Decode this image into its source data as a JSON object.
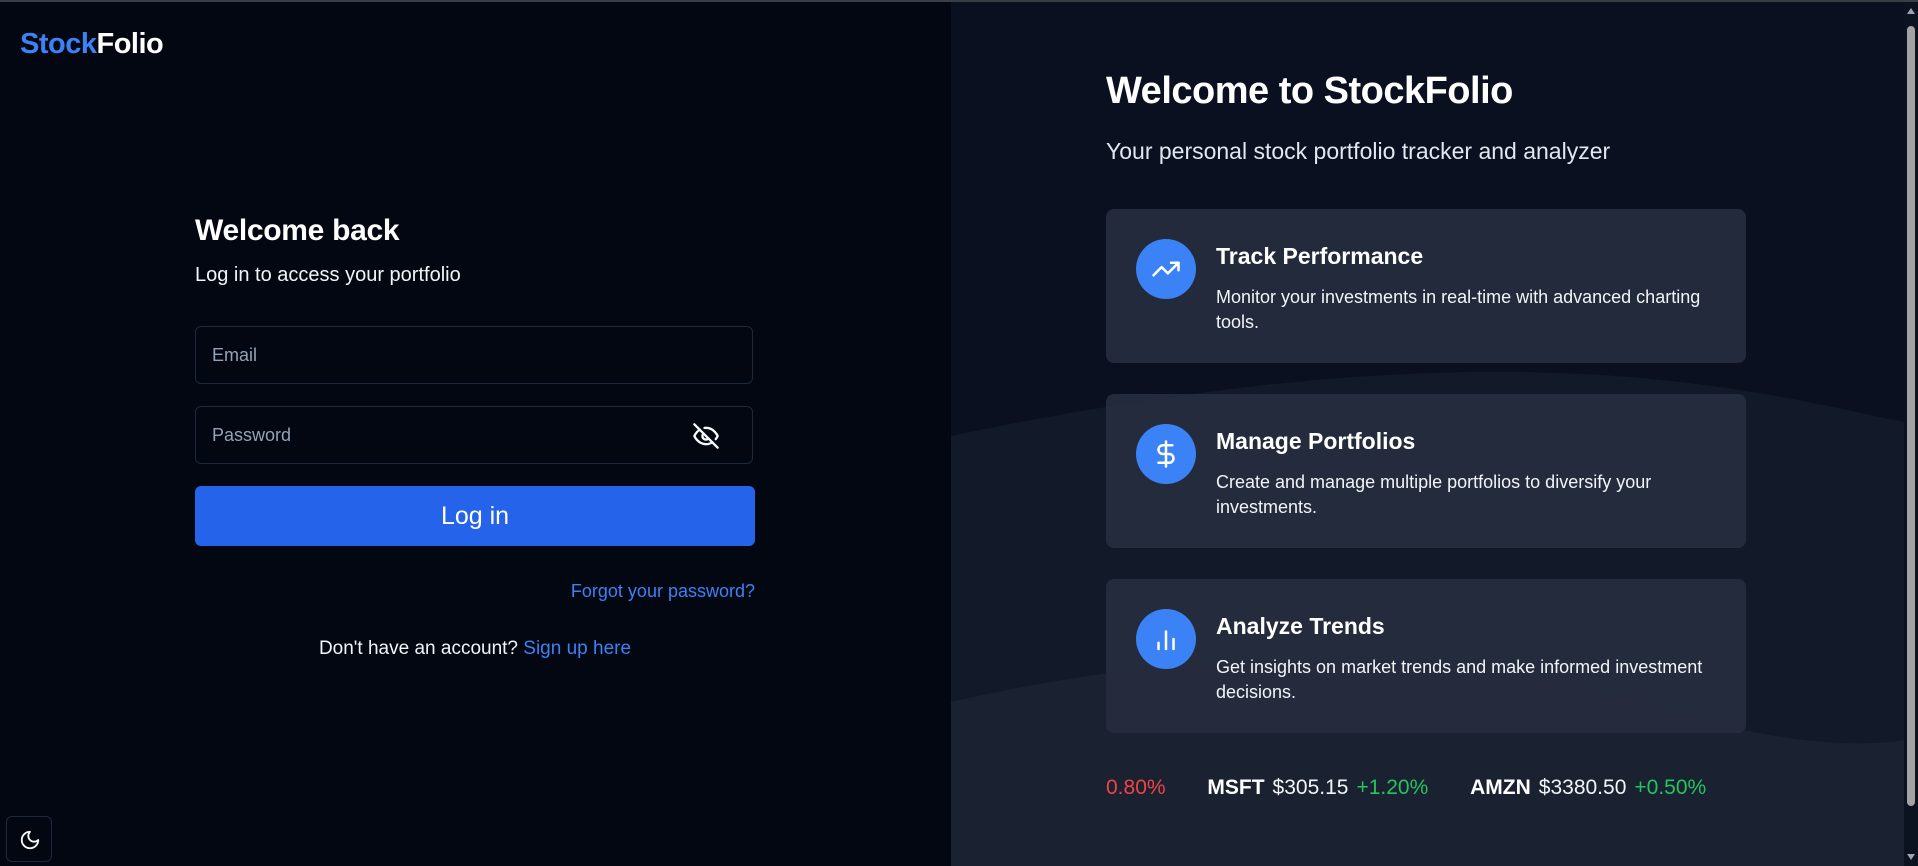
{
  "brand": {
    "part1": "Stock",
    "part2": "Folio"
  },
  "login": {
    "title": "Welcome back",
    "subtitle": "Log in to access your portfolio",
    "email_placeholder": "Email",
    "password_placeholder": "Password",
    "submit_label": "Log in",
    "forgot_label": "Forgot your password?",
    "signup_prompt": "Don't have an account?",
    "signup_link": "Sign up here"
  },
  "hero": {
    "title": "Welcome to StockFolio",
    "subtitle": "Your personal stock portfolio tracker and analyzer"
  },
  "features": [
    {
      "icon": "trending-up-icon",
      "title": "Track Performance",
      "description": "Monitor your investments in real-time with advanced charting tools."
    },
    {
      "icon": "dollar-sign-icon",
      "title": "Manage Portfolios",
      "description": "Create and manage multiple portfolios to diversify your investments."
    },
    {
      "icon": "bar-chart-icon",
      "title": "Analyze Trends",
      "description": "Get insights on market trends and make informed investment decisions."
    }
  ],
  "ticker": [
    {
      "symbol": "",
      "price": "",
      "change": "0.80%",
      "direction": "down"
    },
    {
      "symbol": "MSFT",
      "price": "$305.15",
      "change": "+1.20%",
      "direction": "up"
    },
    {
      "symbol": "AMZN",
      "price": "$3380.50",
      "change": "+0.50%",
      "direction": "up"
    }
  ],
  "colors": {
    "accent": "#3b82f6",
    "button": "#2563eb",
    "positive": "#22c55e",
    "negative": "#ef4444",
    "left_background": "#030711",
    "right_background": "#0a1020",
    "card_background": "#262d3e"
  },
  "icons": {
    "password_toggle": "eye-off-icon",
    "theme_toggle": "moon-icon"
  }
}
